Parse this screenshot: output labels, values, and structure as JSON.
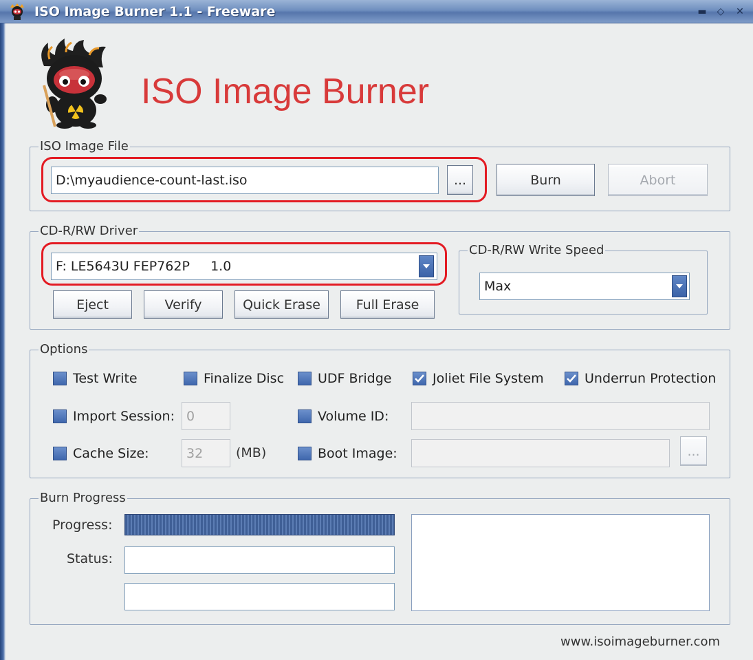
{
  "window": {
    "title": "ISO Image Burner 1.1 - Freeware",
    "controls": [
      "minimize",
      "maximize",
      "close"
    ]
  },
  "header": {
    "app_name": "ISO Image Burner"
  },
  "iso_group": {
    "legend": "ISO Image File",
    "path_value": "D:\\myaudience-count-last.iso",
    "browse_label": "...",
    "burn_label": "Burn",
    "abort_label": "Abort"
  },
  "driver_group": {
    "legend": "CD-R/RW Driver",
    "selected_drive": "F: LE5643U FEP762P     1.0",
    "eject_label": "Eject",
    "verify_label": "Verify",
    "quick_erase_label": "Quick Erase",
    "full_erase_label": "Full Erase"
  },
  "speed_group": {
    "legend": "CD-R/RW Write Speed",
    "selected_speed": "Max"
  },
  "options": {
    "legend": "Options",
    "test_write": {
      "label": "Test Write",
      "checked": false
    },
    "finalize_disc": {
      "label": "Finalize Disc",
      "checked": false
    },
    "udf_bridge": {
      "label": "UDF Bridge",
      "checked": false
    },
    "joliet": {
      "label": "Joliet File System",
      "checked": true
    },
    "underrun": {
      "label": "Underrun Protection",
      "checked": true
    },
    "import_session": {
      "label": "Import Session:",
      "value": "0",
      "checked": false
    },
    "volume_id": {
      "label": "Volume ID:",
      "value": "",
      "checked": false
    },
    "cache_size": {
      "label": "Cache Size:",
      "value": "32",
      "unit": "(MB)",
      "checked": false
    },
    "boot_image": {
      "label": "Boot Image:",
      "value": "",
      "checked": false,
      "browse_label": "..."
    }
  },
  "burn_progress": {
    "legend": "Burn Progress",
    "progress_label": "Progress:",
    "progress_fraction": 1.0,
    "status_label": "Status:",
    "status_value": "",
    "status_value_2": ""
  },
  "footer": {
    "url": "www.isoimageburner.com"
  },
  "colors": {
    "title_bar": "#6f8fbf",
    "app_title": "#d83a3a",
    "highlight": "#e31b23",
    "checkbox": "#3f67ad",
    "progress_fill": "#3f5f96"
  }
}
